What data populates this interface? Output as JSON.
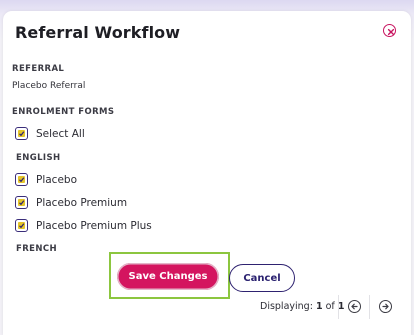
{
  "modal": {
    "title": "Referral Workflow",
    "close_icon": "close-circle-icon"
  },
  "referral": {
    "section_label": "REFERRAL",
    "value": "Placebo Referral"
  },
  "enrolment": {
    "section_label": "ENROLMENT FORMS",
    "select_all": {
      "label": "Select All",
      "checked": true
    },
    "groups": [
      {
        "label": "ENGLISH",
        "items": [
          {
            "label": "Placebo",
            "checked": true
          },
          {
            "label": "Placebo Premium",
            "checked": true
          },
          {
            "label": "Placebo Premium Plus",
            "checked": true
          }
        ]
      },
      {
        "label": "FRENCH",
        "items": []
      }
    ]
  },
  "actions": {
    "save_label": "Save Changes",
    "cancel_label": "Cancel"
  },
  "pagination": {
    "prefix": "Displaying:",
    "current": "1",
    "of_word": "of",
    "total": "1",
    "prev_icon": "arrow-left-circle-icon",
    "next_icon": "arrow-right-circle-icon"
  },
  "colors": {
    "accent": "#d4155f",
    "primary": "#2e2270",
    "highlight": "#8cc63f",
    "checkbox_fill": "#e5c52a"
  }
}
